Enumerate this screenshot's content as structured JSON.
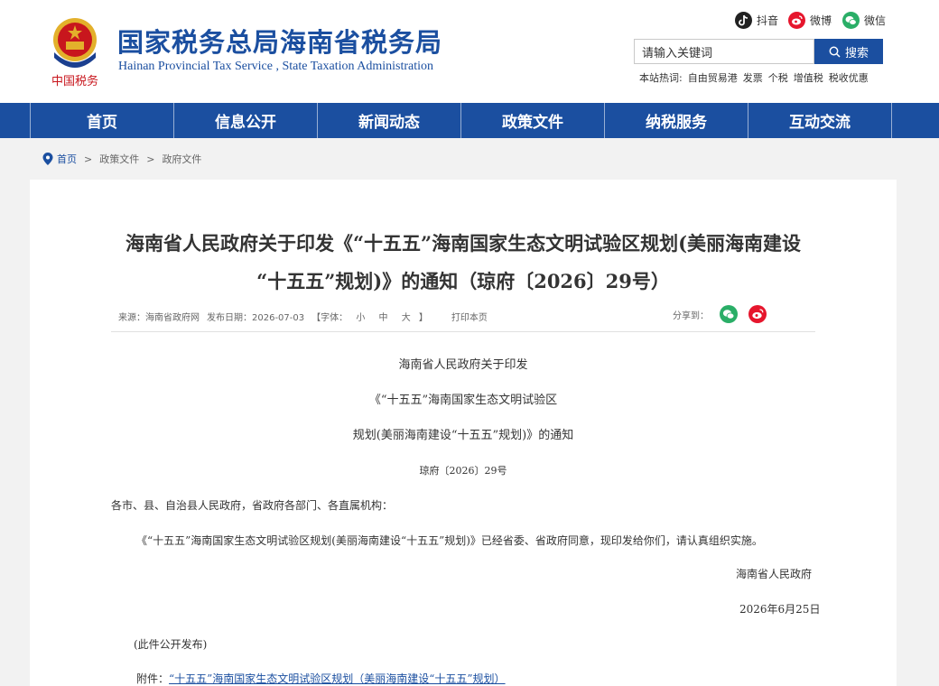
{
  "header": {
    "title_cn": "国家税务总局海南省税务局",
    "title_en": "Hainan Provincial Tax Service , State Taxation Administration",
    "emblem_text": "中国税务",
    "social": [
      {
        "label": "抖音",
        "icon": "douyin-icon",
        "color": "#222222"
      },
      {
        "label": "微博",
        "icon": "weibo-icon",
        "color": "#e6162d"
      },
      {
        "label": "微信",
        "icon": "wechat-icon",
        "color": "#2aae67"
      }
    ],
    "search": {
      "value": "请输入关键词",
      "button_label": "搜索"
    },
    "hot": {
      "label": "本站热词:",
      "items": [
        "自由贸易港",
        "发票",
        "个税",
        "增值税",
        "税收优惠"
      ]
    }
  },
  "nav": [
    "首页",
    "信息公开",
    "新闻动态",
    "政策文件",
    "纳税服务",
    "互动交流"
  ],
  "breadcrumb": [
    "首页",
    "政策文件",
    "政府文件"
  ],
  "article": {
    "title_line1": "海南省人民政府关于印发《“十五五”海南国家生态文明试验区规划(美丽海南建设",
    "title_line2": "“十五五”规划)》的通知（琼府〔2026〕29号）",
    "meta": {
      "source": "来源：海南省政府网",
      "date": "发布日期：2026-07-03",
      "font_label_open": "【字体：",
      "font_small": "小",
      "font_medium": "中",
      "font_large": "大",
      "font_label_close": "】",
      "print": "打印本页",
      "share": "分享到："
    },
    "heading1": "海南省人民政府关于印发",
    "heading2": "《“十五五”海南国家生态文明试验区",
    "heading3": "规划(美丽海南建设“十五五”规划)》的通知",
    "doc_number": "琼府〔2026〕29号",
    "recipients": "各市、县、自治县人民政府，省政府各部门、各直属机构：",
    "body": "《“十五五”海南国家生态文明试验区规划(美丽海南建设“十五五”规划)》已经省委、省政府同意，现印发给你们，请认真组织实施。",
    "signature": "海南省人民政府",
    "sign_date": "2026年6月25日",
    "publish_note": "(此件公开发布)",
    "attachment_label": "附件：",
    "attachment_link": "“十五五”海南国家生态文明试验区规划（美丽海南建设“十五五”规划）"
  },
  "colors": {
    "brand_blue": "#1b4fa0",
    "emblem_red": "#c8161d",
    "emblem_gold": "#e3b02b"
  }
}
